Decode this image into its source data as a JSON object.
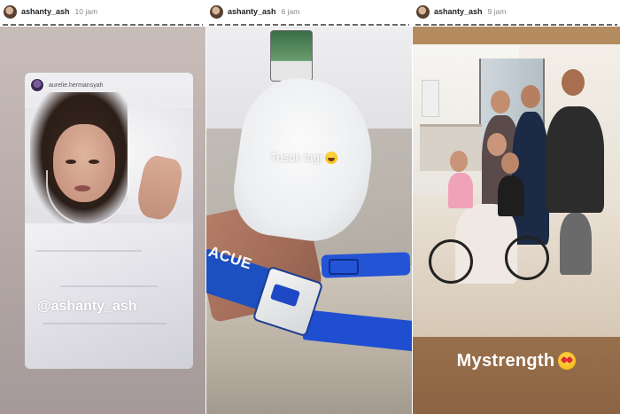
{
  "stories": [
    {
      "username": "ashanty_ash",
      "timestamp": "10 jam",
      "repost_username": "aurelie.hermansyah",
      "mention": "@ashanty_ash"
    },
    {
      "username": "ashanty_ash",
      "timestamp": "6 jam",
      "caption": "Tusuk lagi",
      "caption_emoji": "grinning-face-icon",
      "strap_text": "ACUE"
    },
    {
      "username": "ashanty_ash",
      "timestamp": "9 jam",
      "caption": "Mystrength",
      "caption_emoji": "heart-eyes-face-icon"
    }
  ],
  "colors": {
    "header_text": "#222222",
    "timestamp_text": "#888888",
    "strap_blue": "#1c4fbf",
    "caption_text": "#ffffff"
  }
}
